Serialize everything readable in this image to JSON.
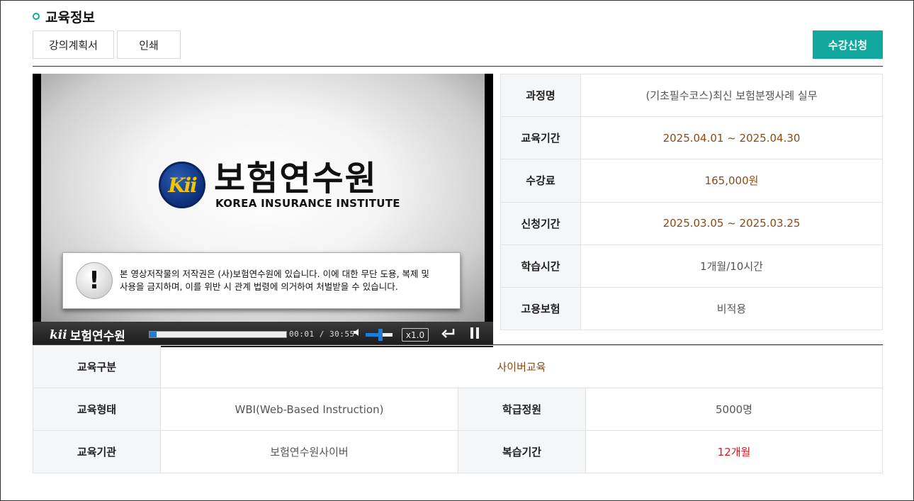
{
  "section": {
    "title": "교육정보"
  },
  "toolbar": {
    "plan_label": "강의계획서",
    "print_label": "인쇄",
    "apply_label": "수강신청"
  },
  "colors": {
    "accent": "#12a89e",
    "brown": "#8a4a14",
    "red": "#e0141e"
  },
  "video": {
    "logo_kr": "보험연수원",
    "logo_en": "KOREA INSURANCE INSTITUTE",
    "logo_emblem": "Kii",
    "notice_line1": "본 영상저작물의 저작권은 (사)보험연수원에 있습니다. 이에 대한 무단 도용, 복제 및",
    "notice_line2": "사용을 금지하며, 이를 위반 시 관계 법령에 의거하여 처벌받을 수 있습니다.",
    "notice_icon": "!",
    "controls": {
      "brand_kii": "kii",
      "brand_name": "보험연수원",
      "current_time": "00:01",
      "separator": "/",
      "duration": "30:55",
      "speed": "x1.0",
      "progress": 0.05,
      "volume": 0.55
    }
  },
  "course_info": [
    {
      "label": "과정명",
      "value": "(기초필수코스)최신 보험분쟁사례 실무"
    },
    {
      "label": "교육기간",
      "value": "2025.04.01 ~ 2025.04.30"
    },
    {
      "label": "수강료",
      "value": "165,000원"
    },
    {
      "label": "신청기간",
      "value": "2025.03.05 ~ 2025.03.25"
    },
    {
      "label": "학습시간",
      "value": "1개월/10시간"
    },
    {
      "label": "고용보험",
      "value": "비적용"
    }
  ],
  "details": {
    "type_label": "교육구분",
    "type_value": "사이버교육",
    "form_label": "교육형태",
    "form_value": "WBI(Web-Based Instruction)",
    "capacity_label": "학급정원",
    "capacity_value": "5000명",
    "org_label": "교육기관",
    "org_value": "보험연수원사이버",
    "review_label": "복습기간",
    "review_value": "12개월"
  }
}
